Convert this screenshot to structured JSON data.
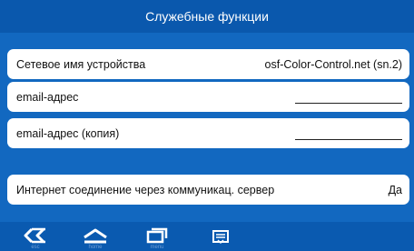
{
  "title": "Служебные функции",
  "rows": [
    {
      "label": "Сетевое имя устройства",
      "value": "osf-Color-Control.net (sn.2)"
    },
    {
      "label": "email-адрес",
      "value": ""
    },
    {
      "label": "email-адрес (копия)",
      "value": ""
    },
    {
      "label": "Интернет соединение через коммуникац. сервер",
      "value": "Да"
    }
  ],
  "nav": {
    "esc_label": "esc",
    "home_label": "home",
    "menu_label": "menu"
  },
  "colors": {
    "background": "#1268c0",
    "titlebar": "#0a58ad",
    "row": "#ffffff"
  },
  "icons": [
    "back-icon",
    "home-icon",
    "menu-icon",
    "dropdown-icon"
  ]
}
